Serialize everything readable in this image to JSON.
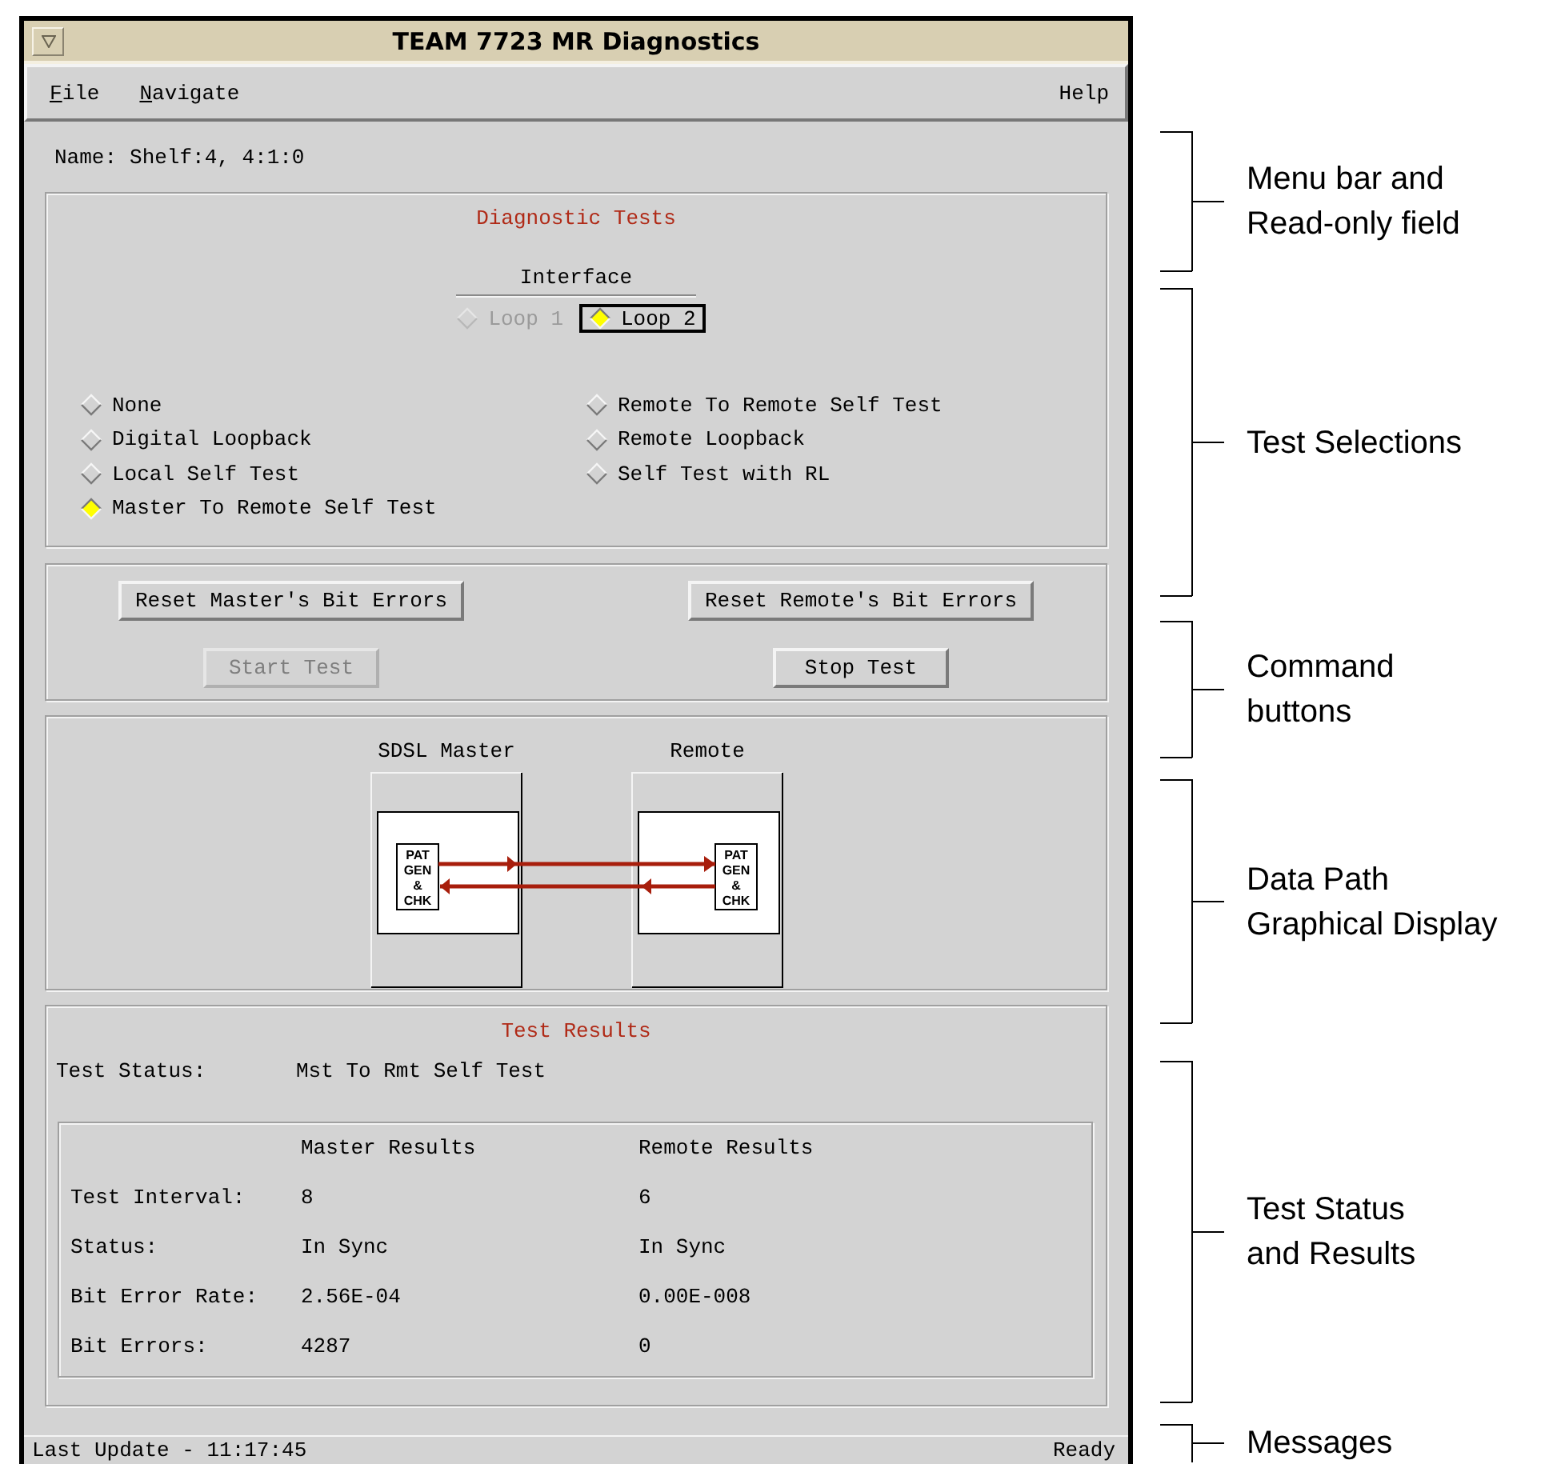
{
  "window": {
    "title": "TEAM 7723 MR Diagnostics"
  },
  "menu_bar": {
    "left": [
      {
        "label": "File",
        "mnemonic": true
      },
      {
        "label": "Navigate",
        "mnemonic": true
      }
    ],
    "right": [
      {
        "label": "Help",
        "mnemonic": false
      }
    ]
  },
  "name_field": {
    "label": "Name:",
    "value": "Shelf:4, 4:1:0"
  },
  "diagnostic_tests": {
    "title": "Diagnostic Tests",
    "interface_label": "Interface",
    "interface_options": [
      {
        "label": "Loop 1",
        "selected": false,
        "disabled": true,
        "focused": false
      },
      {
        "label": "Loop 2",
        "selected": true,
        "disabled": false,
        "focused": true
      }
    ],
    "test_columns": [
      [
        {
          "label": "None",
          "selected": false
        },
        {
          "label": "Digital Loopback",
          "selected": false
        },
        {
          "label": "Local Self Test",
          "selected": false
        },
        {
          "label": "Master To Remote Self Test",
          "selected": true
        }
      ],
      [
        {
          "label": "Remote To Remote Self Test",
          "selected": false
        },
        {
          "label": "Remote Loopback",
          "selected": false
        },
        {
          "label": "Self Test with RL",
          "selected": false
        }
      ]
    ]
  },
  "commands": [
    {
      "label": "Reset Master's Bit Errors",
      "disabled": false
    },
    {
      "label": "Reset Remote's Bit Errors",
      "disabled": false
    },
    {
      "label": "Start Test",
      "disabled": true
    },
    {
      "label": "Stop Test",
      "disabled": false
    }
  ],
  "data_path": {
    "devices": [
      {
        "name": "SDSL Master",
        "pattern_label": [
          "PAT",
          "GEN",
          "&",
          "CHK"
        ]
      },
      {
        "name": "Remote",
        "pattern_label": [
          "PAT",
          "GEN",
          "&",
          "CHK"
        ]
      }
    ]
  },
  "test_results": {
    "title": "Test Results",
    "status_label": "Test Status:",
    "status_value": "Mst To Rmt Self Test",
    "columns": [
      "Master Results",
      "Remote Results"
    ],
    "rows": [
      {
        "label": "Test Interval:",
        "master": "8",
        "remote": "6"
      },
      {
        "label": "Status:",
        "master": "In Sync",
        "remote": "In Sync"
      },
      {
        "label": "Bit Error Rate:",
        "master": "2.56E-04",
        "remote": "0.00E-008"
      },
      {
        "label": "Bit Errors:",
        "master": "4287",
        "remote": "0"
      }
    ]
  },
  "status_bar": {
    "message": "Last Update - 11:17:45",
    "state": "Ready"
  },
  "annotations": [
    {
      "lines": [
        "Menu bar and",
        "Read-only field"
      ]
    },
    {
      "lines": [
        "Test Selections"
      ]
    },
    {
      "lines": [
        "Command",
        "buttons"
      ]
    },
    {
      "lines": [
        "Data Path",
        "Graphical Display"
      ]
    },
    {
      "lines": [
        "Test Status",
        "and Results"
      ]
    },
    {
      "lines": [
        "Messages"
      ]
    }
  ]
}
